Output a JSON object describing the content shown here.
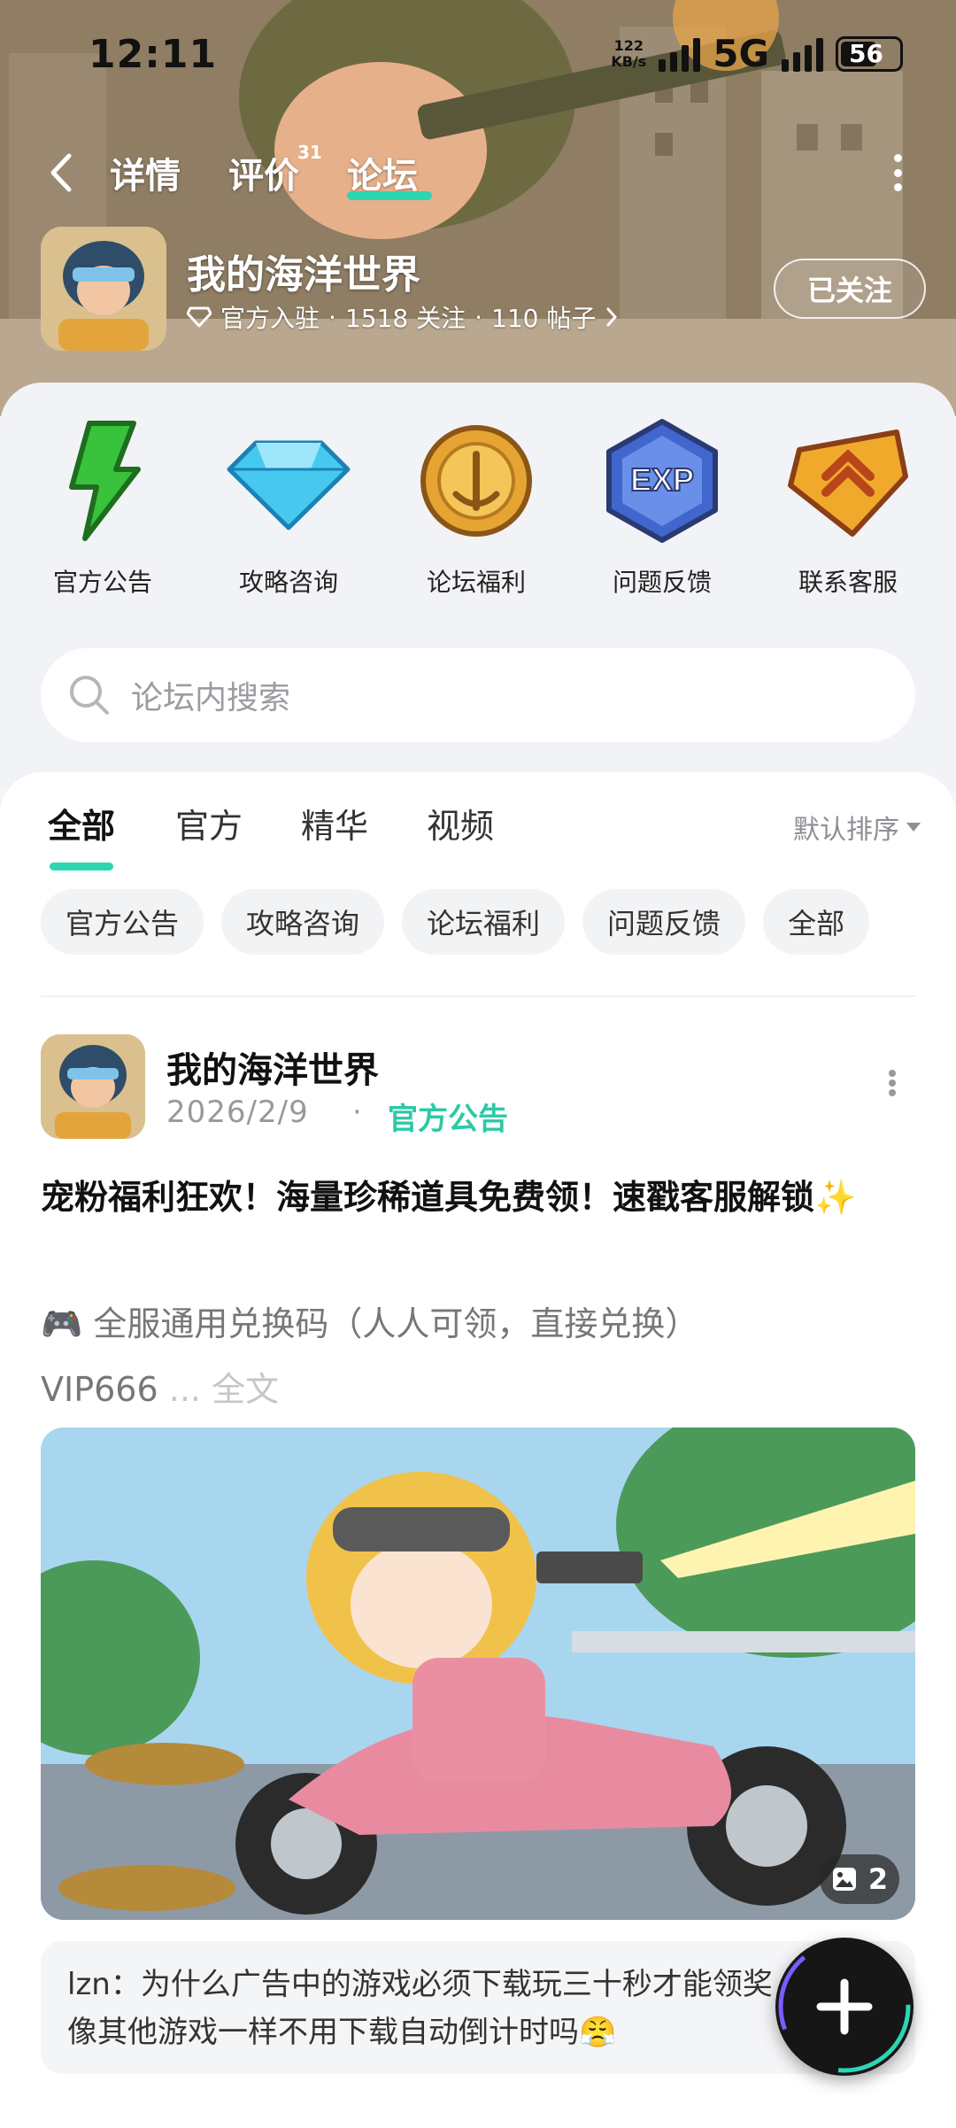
{
  "status": {
    "time": "12:11",
    "speed_value": "122",
    "speed_unit": "KB/s",
    "network": "5G",
    "battery": "56"
  },
  "nav": {
    "tabs": [
      {
        "label": "详情"
      },
      {
        "label": "评价"
      },
      {
        "label": "论坛"
      }
    ],
    "review_count": "31",
    "active_tab": "论坛"
  },
  "game": {
    "title": "我的海洋世界",
    "official_label": "官方入驻",
    "followers": "1518 关注",
    "posts": "110 帖子",
    "follow_label": "已关注"
  },
  "categories": [
    {
      "label": "官方公告",
      "icon": "lightning-icon"
    },
    {
      "label": "攻略咨询",
      "icon": "diamond-icon"
    },
    {
      "label": "论坛福利",
      "icon": "gold-coin-icon"
    },
    {
      "label": "问题反馈",
      "icon": "exp-badge-icon"
    },
    {
      "label": "联系客服",
      "icon": "rank-badge-icon"
    }
  ],
  "search": {
    "placeholder": "论坛内搜索"
  },
  "feed_tabs": [
    {
      "label": "全部"
    },
    {
      "label": "官方"
    },
    {
      "label": "精华"
    },
    {
      "label": "视频"
    }
  ],
  "sort_label": "默认排序",
  "chips": [
    "官方公告",
    "攻略咨询",
    "论坛福利",
    "问题反馈",
    "全部"
  ],
  "post": {
    "author": "我的海洋世界",
    "date": "2026/2/9",
    "separator": "·",
    "tag": "官方公告",
    "title": "宠粉福利狂欢！海量珍稀道具免费领！速戳客服解锁✨",
    "body_line1": "🎮 全服通用兑换码（人人可领，直接兑换）",
    "body_line2": "VIP666",
    "ellipsis": " ... ",
    "full_text": "全文",
    "image_count": "2"
  },
  "comment": {
    "user": "lzn：",
    "text": "为什么广告中的游戏必须下载玩三十秒才能领奖，不能像其他游戏一样不用下载自动倒计时吗😤"
  },
  "colors": {
    "accent": "#2cd6b2",
    "tag_green": "#2cc9a7"
  }
}
